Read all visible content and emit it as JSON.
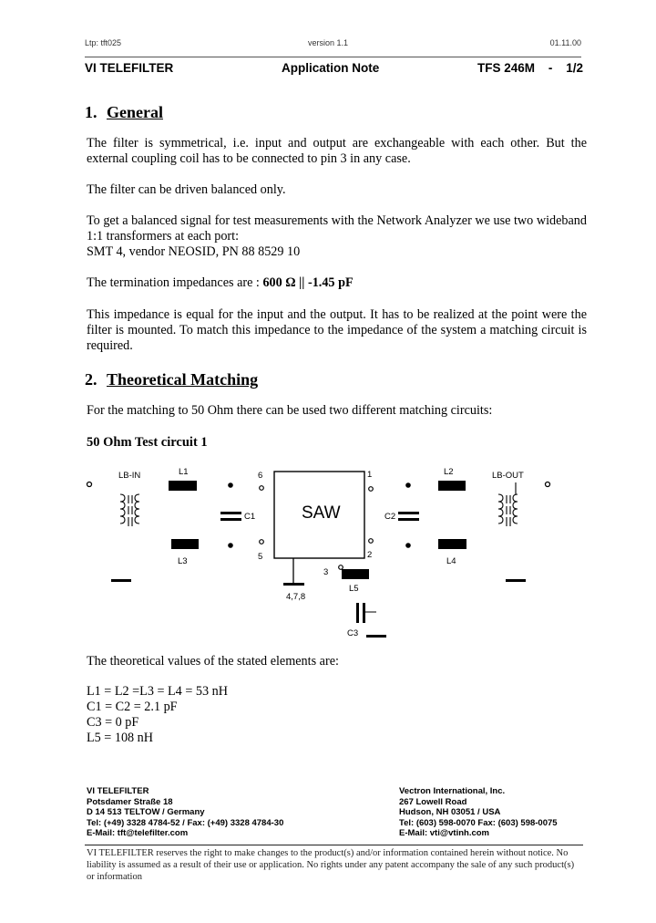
{
  "meta": {
    "ltp": "Ltp: tft025",
    "version": "version 1.1",
    "date": "01.11.00"
  },
  "header": {
    "company": "VI TELEFILTER",
    "doc_type": "Application Note",
    "part": "TFS 246M",
    "dash": "-",
    "page": "1/2"
  },
  "section1": {
    "number": "1.",
    "title": "General",
    "p1": "The filter is symmetrical, i.e. input and output are exchangeable with each other. But the external coupling coil has to be connected to pin 3 in any case.",
    "p2": "The filter can be driven balanced only.",
    "p3_line1": "To get a balanced signal for test measurements with the Network Analyzer we use two wideband 1:1 transformers at each port:",
    "p3_line2": "SMT 4, vendor NEOSID, PN 88 8529 10",
    "p4_prefix": "The termination impedances are : ",
    "p4_value": "600 Ω || -1.45 pF",
    "p5": "This impedance is equal for the input and the output. It has to be realized at the point were the filter is mounted. To match this impedance to the impedance of the system a matching circuit is required."
  },
  "section2": {
    "number": "2.",
    "title": "Theoretical Matching",
    "p1": "For the matching to 50 Ohm there can be used two different matching circuits:",
    "subtitle": "50 Ohm Test circuit 1"
  },
  "diagram": {
    "lb_in": "LB-IN",
    "lb_out": "LB-OUT",
    "l1": "L1",
    "l2": "L2",
    "l3": "L3",
    "l4": "L4",
    "l5": "L5",
    "c1": "C1",
    "c2": "C2",
    "c3": "C3",
    "saw": "SAW",
    "pin1": "1",
    "pin2": "2",
    "pin3": "3",
    "pin5": "5",
    "pin6": "6",
    "ground_pins": "4,7,8"
  },
  "values": {
    "intro": "The theoretical values of the stated elements are:",
    "lines": [
      "L1 = L2 =L3 = L4 = 53 nH",
      "C1 = C2 = 2.1 pF",
      "C3 = 0 pF",
      "L5 = 108 nH"
    ]
  },
  "footer": {
    "left": {
      "company": "VI TELEFILTER",
      "street": "Potsdamer Straße 18",
      "city": "D 14 513 TELTOW / Germany",
      "phone": "Tel: (+49) 3328 4784-52 / Fax: (+49) 3328 4784-30",
      "email": "E-Mail: tft@telefilter.com"
    },
    "right": {
      "company": "Vectron International, Inc.",
      "street": "267 Lowell Road",
      "city": "Hudson, NH 03051 / USA",
      "phone": "Tel: (603) 598-0070 Fax: (603) 598-0075",
      "email": "E-Mail: vti@vtinh.com"
    },
    "disclaimer": "VI TELEFILTER reserves the right to make changes to the product(s) and/or information contained herein without notice. No liability is assumed as a result of their use or application. No rights under any patent accompany the sale of any such product(s) or information"
  }
}
